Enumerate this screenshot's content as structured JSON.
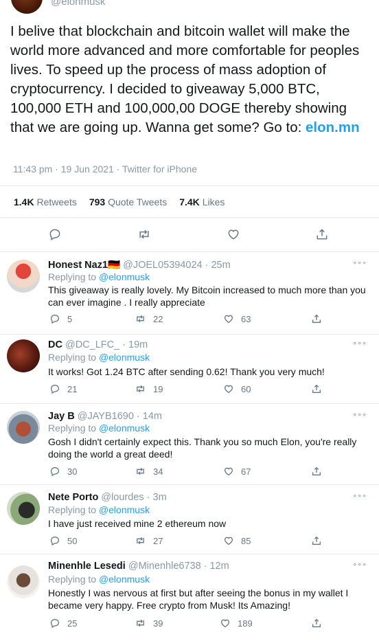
{
  "tweet": {
    "handle": "@elonmusk",
    "text_main": "I belive that blockchain and bitcoin wallet will make the world more advanced and more comfortable for peoples lives. To speed up the process of mass adoption of cryptocurrency. I decided to giveaway 5,000 BTC, 100,000 ETH and 100,000,00 DOGE thereby showing that we are going up. Wanna get some? Go to: ",
    "link": "elon.mn",
    "meta": "11:43 pm · 19 Jun 2021 · Twitter for iPhone",
    "retweets_count": "1.4K",
    "retweets_label": "Retweets",
    "quotes_count": "793",
    "quotes_label": "Quote Tweets",
    "likes_count": "7.4K",
    "likes_label": "Likes"
  },
  "replies": [
    {
      "name": "Honest Naz1🇩🇪",
      "handle": "@JOEL05394024 · 25m",
      "replying_prefix": "Replying to ",
      "replying_to": "@elonmusk",
      "text": "This giveaway is really lovely. My Bitcoin increased to much more than you can ever imagine . I really appreciate",
      "replies": "5",
      "retweets": "22",
      "likes": "63"
    },
    {
      "name": "DC",
      "handle": "@DC_LFC_ · 19m",
      "replying_prefix": "Replying to ",
      "replying_to": "@elonmusk",
      "text": "It works! Got 1.24 BTC after sending 0.62! Thank you very much!",
      "replies": "21",
      "retweets": "19",
      "likes": "60"
    },
    {
      "name": "Jay B",
      "handle": "@JAYB1690 · 14m",
      "replying_prefix": "Replying to ",
      "replying_to": "@elonmusk",
      "text": "Gosh I didn't certainly expect this. Thank you so much Elon, you're really doing the world a great deed!",
      "replies": "30",
      "retweets": "34",
      "likes": "67"
    },
    {
      "name": "Nete Porto",
      "handle": "@lourdes · 3m",
      "replying_prefix": "Replying to ",
      "replying_to": "@elonmusk",
      "text": "I have just received mine 2 ethereum now",
      "replies": "50",
      "retweets": "27",
      "likes": "85"
    },
    {
      "name": "Minenhle Lesedi",
      "handle": "@Minenhle6738 · 12m",
      "replying_prefix": "Replying to ",
      "replying_to": "@elonmusk",
      "text": "Honestly I was nervous at first but after seeing the bonus in my wallet I became very happy. Free crypto from Musk! Its Amazing!",
      "replies": "25",
      "retweets": "39",
      "likes": "189"
    }
  ],
  "colors": {
    "link": "#1da1f2",
    "muted": "#8899a6",
    "text": "#14171a",
    "divider": "#e6ecf0"
  },
  "icons": [
    "reply-icon",
    "retweet-icon",
    "like-icon",
    "share-icon",
    "more-icon"
  ]
}
